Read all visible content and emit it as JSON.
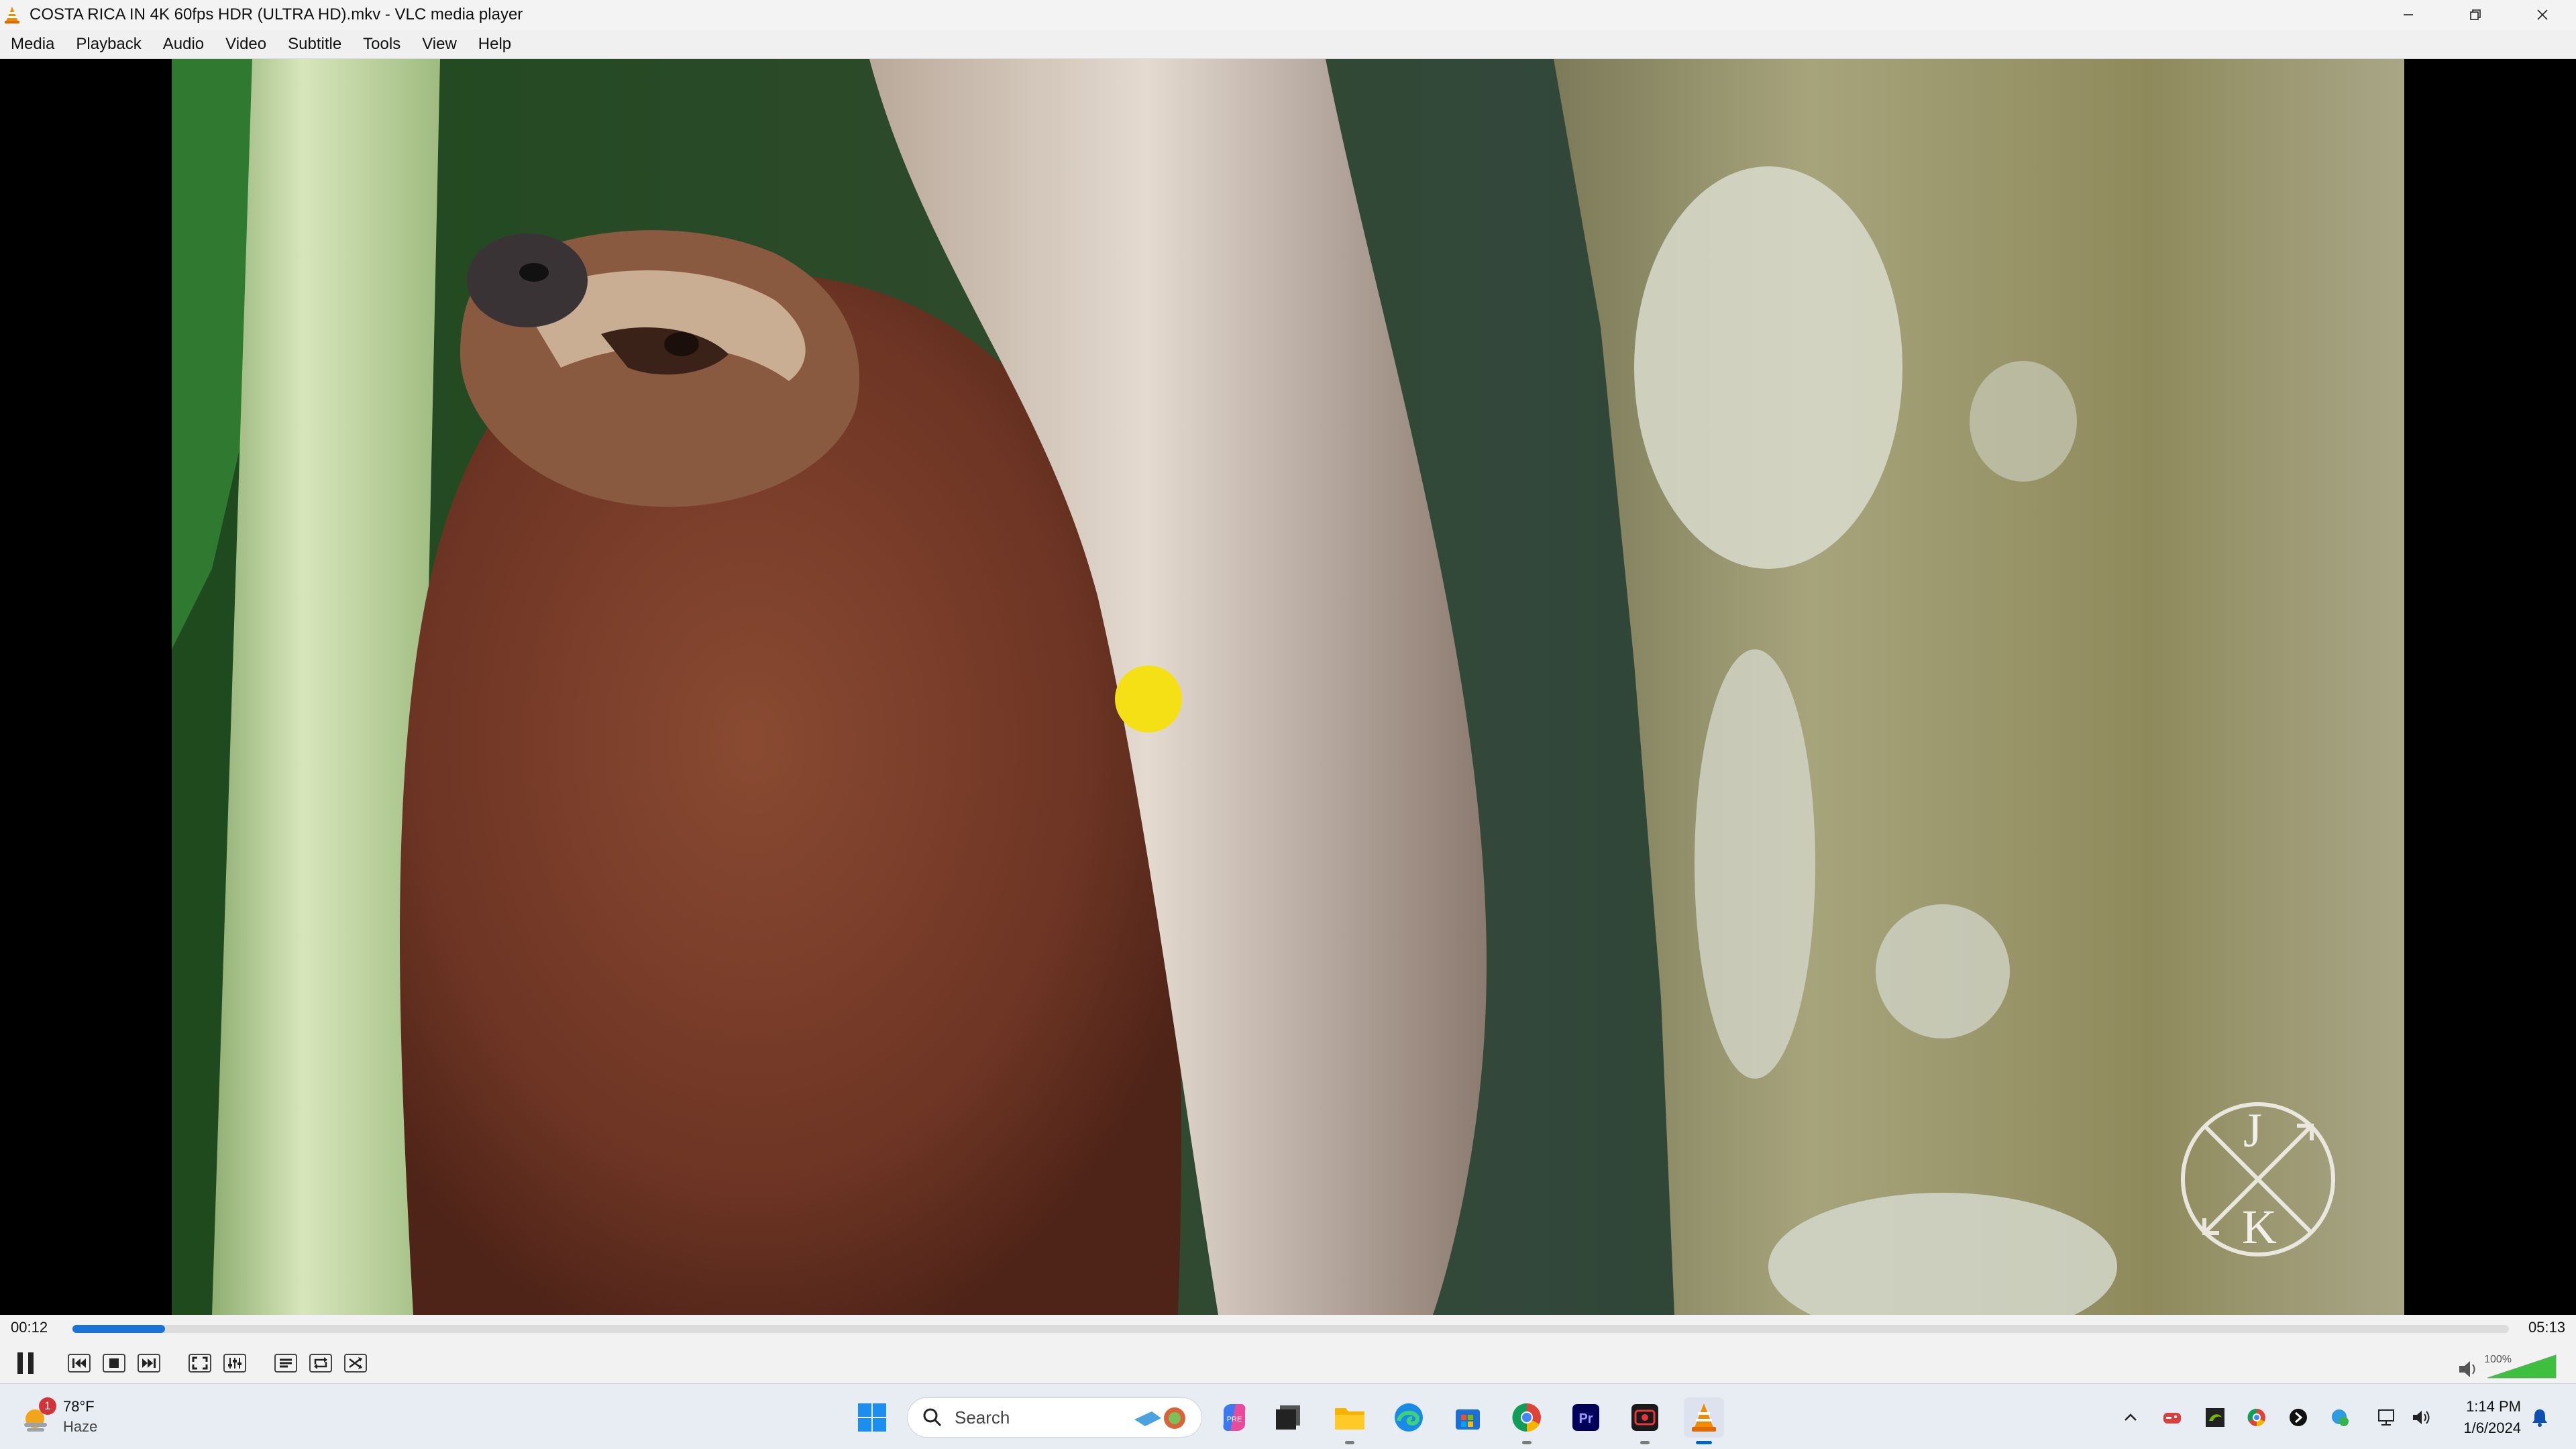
{
  "window": {
    "title": "COSTA RICA IN 4K 60fps HDR (ULTRA HD).mkv - VLC media player",
    "icon": "vlc-cone-icon"
  },
  "menu": [
    "Media",
    "Playback",
    "Audio",
    "Video",
    "Subtitle",
    "Tools",
    "View",
    "Help"
  ],
  "video": {
    "watermark_top": "J",
    "watermark_bottom": "K"
  },
  "playback": {
    "elapsed": "00:12",
    "total": "05:13",
    "progress": 0.038,
    "volume_label": "100%",
    "volume": 1.0,
    "accent_color": "#1a73d9"
  },
  "controls": {
    "buttons": [
      "pause-icon",
      "previous-icon",
      "stop-icon",
      "next-icon",
      "fullscreen-icon",
      "extended-settings-icon",
      "playlist-icon",
      "loop-icon",
      "shuffle-icon"
    ]
  },
  "taskbar": {
    "weather": {
      "temp": "78°F",
      "condition": "Haze",
      "badge": "1"
    },
    "search_label": "Search",
    "clock": {
      "time": "1:14 PM",
      "date": "1/6/2024"
    }
  }
}
